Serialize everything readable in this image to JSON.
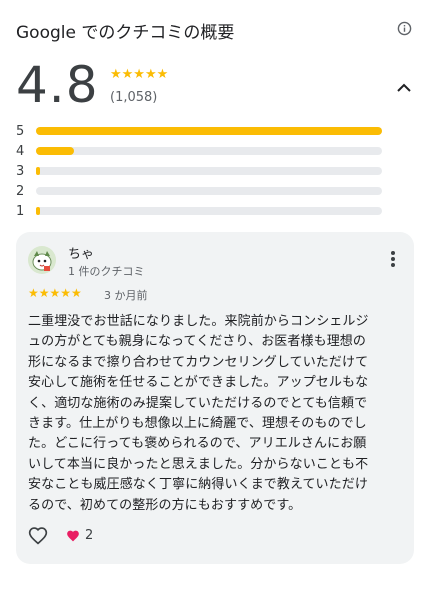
{
  "header": {
    "title": "Google でのクチコミの概要"
  },
  "summary": {
    "rating": "4.8",
    "stars": "★★★★★",
    "count": "(1,058)"
  },
  "distribution": [
    {
      "label": "5",
      "fraction": 1.0
    },
    {
      "label": "4",
      "fraction": 0.11
    },
    {
      "label": "3",
      "fraction": 0.008
    },
    {
      "label": "2",
      "fraction": 0.0
    },
    {
      "label": "1",
      "fraction": 0.008
    }
  ],
  "review": {
    "author": "ちゃ",
    "author_sub": "1 件のクチコミ",
    "stars": "★★★★★",
    "time": "3 か月前",
    "text_lines": [
      "二重埋没でお世話になりました。来院前からコンシェルジ",
      "ュの方がとても親身になってくださり、お医者様も理想の",
      "形になるまで擦り合わせてカウンセリングしていただけて",
      "安心して施術を任せることができました。アップセルもな",
      "く、適切な施術のみ提案していただけるのでとても信頼で",
      "きます。仕上がりも想像以上に綺麗で、理想そのものでし",
      "た。どこに行っても褒められるので、アリエルさんにお願",
      "いして本当に良かったと思えました。分からないことも不",
      "安なことも威圧感なく丁寧に納得いくまで教えていただけ",
      "るので、初めての整形の方にもおすすめです。"
    ],
    "reaction_count": "2"
  },
  "colors": {
    "star": "#fbbc04",
    "track": "#e8eaed",
    "card": "#f1f3f4",
    "heart": "#e91e63"
  }
}
